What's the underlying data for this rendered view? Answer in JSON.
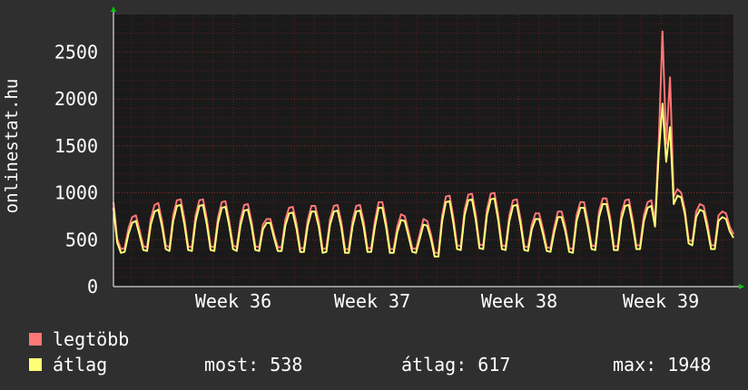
{
  "chart_data": {
    "type": "line",
    "ylabel": "onlinestat.hu",
    "ylim": [
      0,
      2900
    ],
    "yticks": [
      0,
      500,
      1000,
      1500,
      2000,
      2500
    ],
    "xticks": [
      "Week 36",
      "Week 37",
      "Week 38",
      "Week 39"
    ],
    "grid": true,
    "legend_position": "bottom-left",
    "background": "#1a1a1a",
    "gridColor": "#7a1a1a",
    "series": [
      {
        "name": "legtöbb",
        "color": "#ff7777",
        "values": [
          900,
          510,
          400,
          410,
          620,
          740,
          760,
          600,
          430,
          420,
          720,
          870,
          890,
          700,
          440,
          420,
          760,
          920,
          930,
          720,
          430,
          420,
          760,
          920,
          930,
          720,
          430,
          420,
          740,
          900,
          910,
          700,
          440,
          420,
          710,
          870,
          880,
          690,
          430,
          420,
          660,
          720,
          720,
          560,
          420,
          420,
          710,
          840,
          850,
          680,
          410,
          410,
          710,
          860,
          860,
          690,
          400,
          410,
          720,
          860,
          870,
          690,
          400,
          400,
          700,
          860,
          870,
          690,
          410,
          410,
          700,
          900,
          900,
          690,
          400,
          400,
          640,
          770,
          750,
          590,
          410,
          400,
          560,
          720,
          700,
          560,
          360,
          360,
          760,
          960,
          970,
          740,
          440,
          430,
          820,
          980,
          990,
          770,
          450,
          440,
          820,
          990,
          1000,
          770,
          440,
          430,
          760,
          920,
          930,
          720,
          430,
          420,
          660,
          780,
          780,
          610,
          420,
          410,
          630,
          800,
          800,
          640,
          410,
          400,
          760,
          900,
          900,
          700,
          440,
          430,
          800,
          940,
          940,
          740,
          430,
          430,
          780,
          920,
          930,
          720,
          440,
          440,
          760,
          900,
          920,
          700,
          1550,
          2720,
          1520,
          2230,
          960,
          1040,
          1000,
          820,
          500,
          480,
          800,
          880,
          860,
          680,
          440,
          440,
          760,
          800,
          780,
          640,
          560
        ]
      },
      {
        "name": "átlag",
        "color": "#ffff77",
        "values": [
          840,
          470,
          360,
          370,
          560,
          680,
          700,
          550,
          390,
          380,
          660,
          800,
          820,
          640,
          400,
          380,
          700,
          860,
          870,
          660,
          390,
          380,
          700,
          860,
          870,
          660,
          390,
          380,
          680,
          840,
          850,
          650,
          400,
          380,
          650,
          810,
          820,
          640,
          390,
          380,
          610,
          680,
          680,
          520,
          380,
          380,
          650,
          780,
          790,
          620,
          370,
          370,
          650,
          800,
          800,
          630,
          360,
          370,
          660,
          800,
          810,
          630,
          360,
          360,
          640,
          800,
          810,
          630,
          370,
          370,
          640,
          840,
          840,
          630,
          360,
          360,
          580,
          710,
          700,
          540,
          370,
          360,
          510,
          660,
          650,
          510,
          320,
          320,
          700,
          900,
          910,
          680,
          400,
          390,
          760,
          920,
          930,
          710,
          410,
          400,
          760,
          930,
          940,
          710,
          400,
          390,
          700,
          860,
          870,
          660,
          390,
          380,
          610,
          720,
          720,
          560,
          380,
          370,
          580,
          740,
          740,
          590,
          370,
          360,
          700,
          840,
          840,
          640,
          400,
          390,
          740,
          880,
          880,
          680,
          390,
          390,
          720,
          860,
          870,
          660,
          400,
          400,
          700,
          840,
          860,
          640,
          1420,
          1950,
          1330,
          1700,
          880,
          970,
          950,
          770,
          460,
          440,
          740,
          820,
          800,
          620,
          400,
          400,
          700,
          740,
          720,
          590,
          520
        ]
      }
    ]
  },
  "legend": {
    "items": [
      {
        "label": "legtöbb",
        "color": "#ff7777"
      },
      {
        "label": "átlag",
        "color": "#ffff77"
      }
    ]
  },
  "stats": {
    "current": "most: 538",
    "average": "átlag: 617",
    "max": "max: 1948"
  }
}
